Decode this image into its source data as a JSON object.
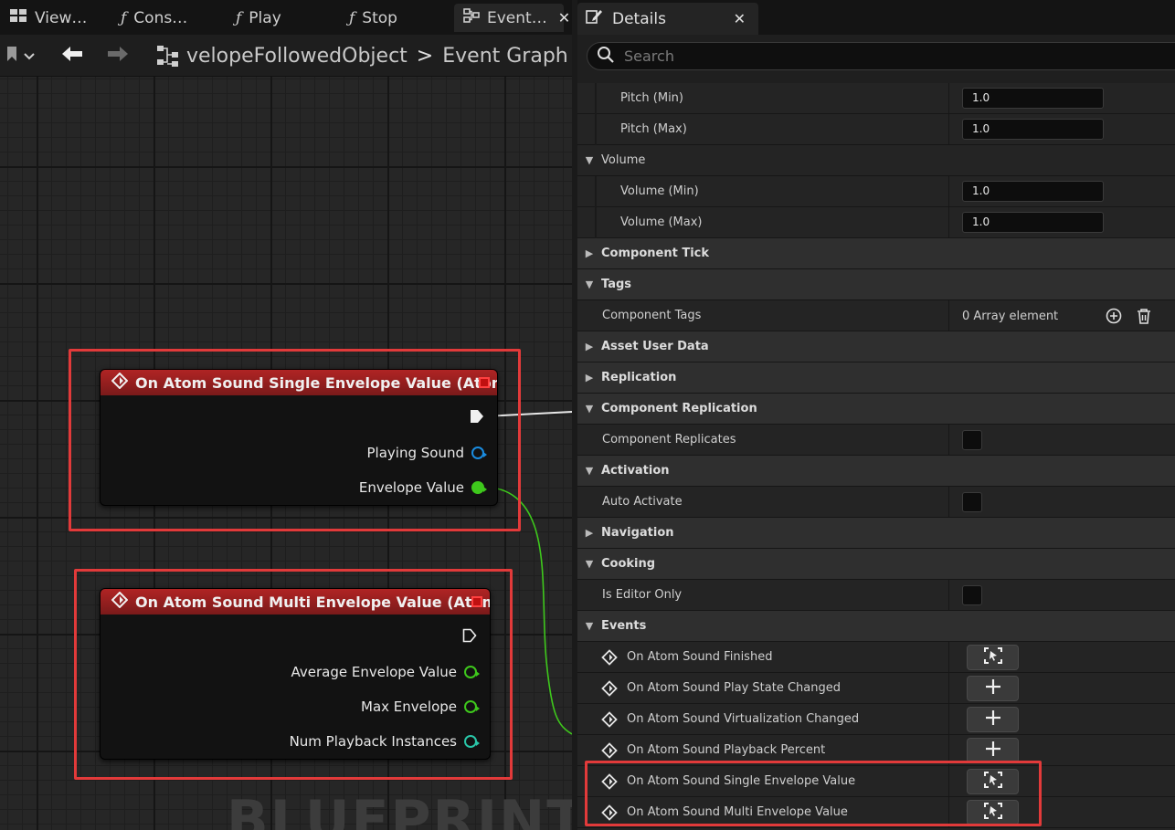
{
  "graph": {
    "tabs": [
      {
        "label": "View…",
        "icon": "grid-icon"
      },
      {
        "label": "Cons…",
        "icon": "function-icon"
      },
      {
        "label": "Play",
        "icon": "function-icon"
      },
      {
        "label": "Stop",
        "icon": "function-icon"
      },
      {
        "label": "Event…",
        "icon": "event-graph-icon"
      }
    ],
    "breadcrumb": {
      "blueprint": "velopeFollowedObject",
      "separator": ">",
      "graph": "Event Graph"
    },
    "watermark": "BLUEPRINT",
    "nodes": [
      {
        "title": "On Atom Sound Single Envelope Value (Atom)",
        "pins": [
          {
            "label": "Playing Sound",
            "type": "object"
          },
          {
            "label": "Envelope Value",
            "type": "float"
          }
        ]
      },
      {
        "title": "On Atom Sound Multi Envelope Value (Atom)",
        "pins": [
          {
            "label": "Average Envelope Value",
            "type": "float"
          },
          {
            "label": "Max Envelope",
            "type": "float"
          },
          {
            "label": "Num Playback Instances",
            "type": "int"
          }
        ]
      }
    ]
  },
  "details": {
    "tab_label": "Details",
    "search_placeholder": "Search",
    "rows": [
      {
        "kind": "prop",
        "indent": 2,
        "label": "Pitch (Min)",
        "value": "1.0",
        "control": "input"
      },
      {
        "kind": "prop",
        "indent": 2,
        "label": "Pitch (Max)",
        "value": "1.0",
        "control": "input"
      },
      {
        "kind": "subcat",
        "label": "Volume",
        "expanded": true
      },
      {
        "kind": "prop",
        "indent": 2,
        "label": "Volume (Min)",
        "value": "1.0",
        "control": "input"
      },
      {
        "kind": "prop",
        "indent": 2,
        "label": "Volume (Max)",
        "value": "1.0",
        "control": "input"
      },
      {
        "kind": "category",
        "label": "Component Tick",
        "expanded": false
      },
      {
        "kind": "category",
        "label": "Tags",
        "expanded": true
      },
      {
        "kind": "prop",
        "indent": 1,
        "label": "Component Tags",
        "value": "0 Array element",
        "control": "array"
      },
      {
        "kind": "category",
        "label": "Asset User Data",
        "expanded": false
      },
      {
        "kind": "category",
        "label": "Replication",
        "expanded": false
      },
      {
        "kind": "category",
        "label": "Component Replication",
        "expanded": true
      },
      {
        "kind": "prop",
        "indent": 1,
        "label": "Component Replicates",
        "control": "checkbox"
      },
      {
        "kind": "category",
        "label": "Activation",
        "expanded": true
      },
      {
        "kind": "prop",
        "indent": 1,
        "label": "Auto Activate",
        "control": "checkbox"
      },
      {
        "kind": "category",
        "label": "Navigation",
        "expanded": false
      },
      {
        "kind": "category",
        "label": "Cooking",
        "expanded": true
      },
      {
        "kind": "prop",
        "indent": 1,
        "label": "Is Editor Only",
        "control": "checkbox"
      },
      {
        "kind": "category",
        "label": "Events",
        "expanded": true
      },
      {
        "kind": "event",
        "label": "On Atom Sound Finished",
        "action": "view"
      },
      {
        "kind": "event",
        "label": "On Atom Sound Play State Changed",
        "action": "add"
      },
      {
        "kind": "event",
        "label": "On Atom Sound Virtualization Changed",
        "action": "add"
      },
      {
        "kind": "event",
        "label": "On Atom Sound Playback Percent",
        "action": "add"
      },
      {
        "kind": "event",
        "label": "On Atom Sound Single Envelope Value",
        "action": "view"
      },
      {
        "kind": "event",
        "label": "On Atom Sound Multi Envelope Value",
        "action": "view"
      }
    ]
  },
  "colors": {
    "highlight": "#e23a3a",
    "node_header": "#b02424",
    "float_pin": "#3ec81c",
    "object_pin": "#1a8ce0",
    "int_pin": "#29c6a8"
  }
}
